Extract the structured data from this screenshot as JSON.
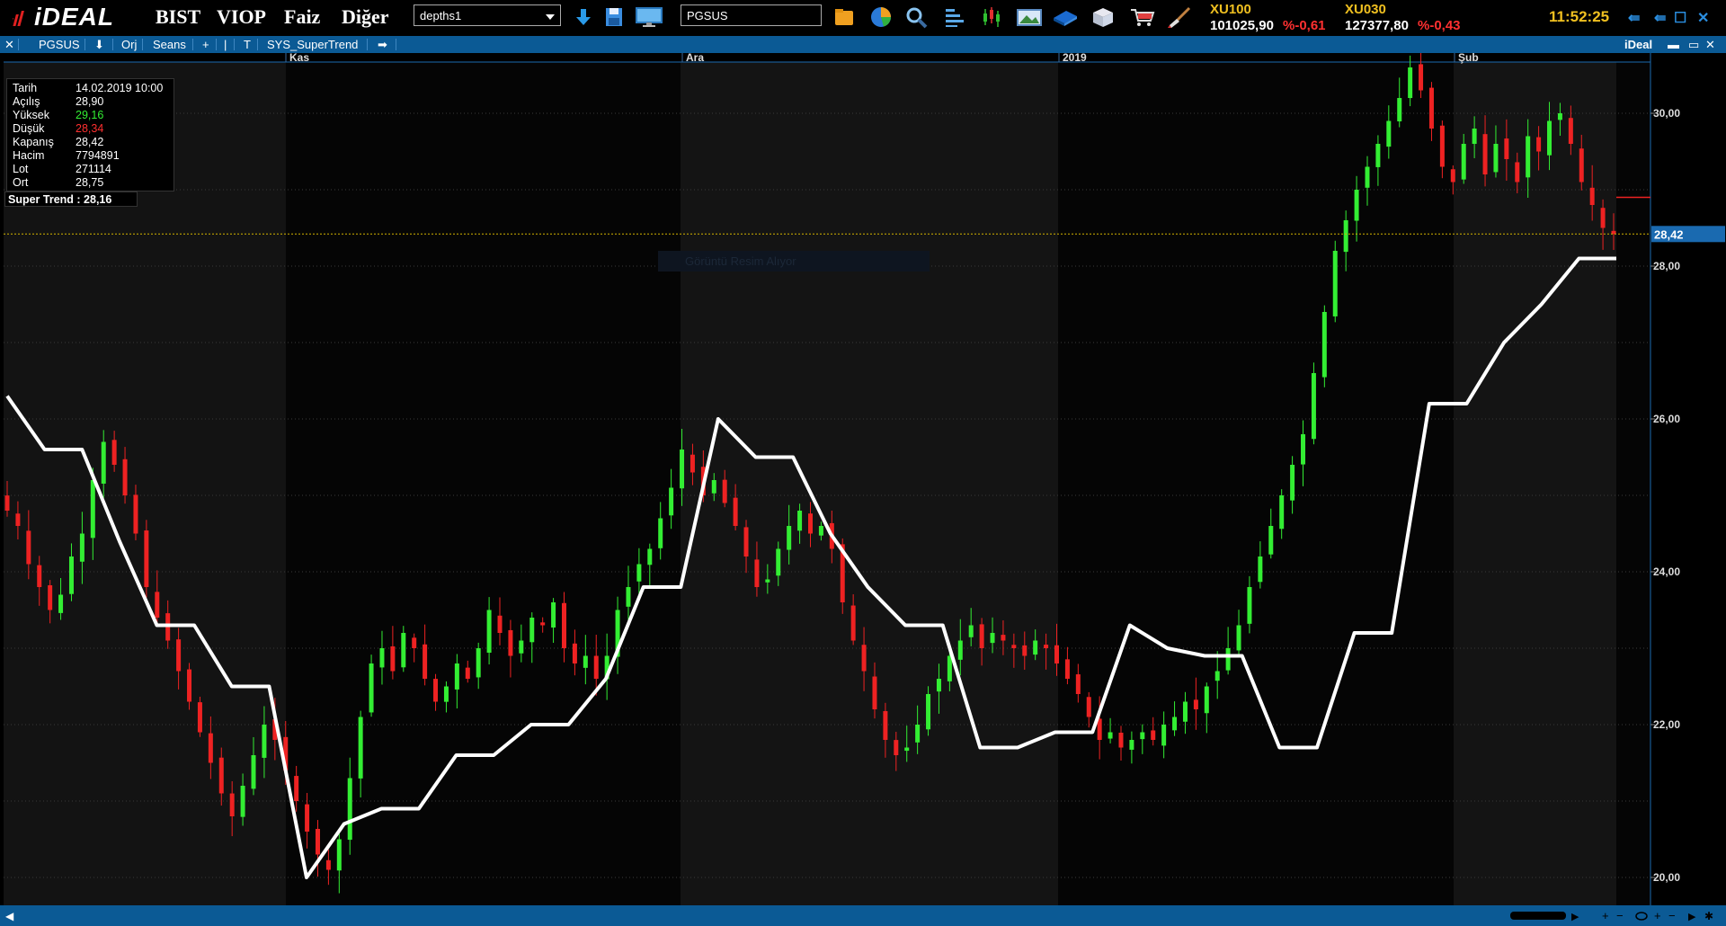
{
  "app": {
    "logo": "iDEAL",
    "menu": [
      "BIST",
      "VIOP",
      "Faiz",
      "Diğer"
    ],
    "layout_combo": "depths1",
    "symbol_input": "PGSUS",
    "clock": "11:52:25"
  },
  "toolbar_icons": [
    "download-icon",
    "save-icon",
    "monitor-icon",
    "folder-icon",
    "pie-chart-icon",
    "zoom-icon",
    "bar-list-icon",
    "candlestick-icon",
    "image-icon",
    "book-icon",
    "box-icon",
    "cart-icon",
    "brush-icon"
  ],
  "indices": [
    {
      "name": "XU100",
      "value": "101025,90",
      "change": "%-0,61"
    },
    {
      "name": "XU030",
      "value": "127377,80",
      "change": "%-0,43"
    }
  ],
  "window_buttons": [
    "⇚",
    "⇚",
    "☐",
    "✕"
  ],
  "chart_toolbar": {
    "items": [
      "✕",
      "PGSUS",
      "⬇",
      "Orj",
      "Seans",
      "+",
      "|",
      "T",
      "SYS_SuperTrend",
      "➡"
    ],
    "right_label": "iDeal",
    "right_controls": [
      "▬",
      "▭",
      "✕"
    ]
  },
  "info": {
    "rows": [
      {
        "label": "Tarih",
        "value": "14.02.2019 10:00",
        "color": "#ffffff"
      },
      {
        "label": "Açılış",
        "value": "28,90",
        "color": "#ffffff"
      },
      {
        "label": "Yüksek",
        "value": "29,16",
        "color": "#33ee33"
      },
      {
        "label": "Düşük",
        "value": "28,34",
        "color": "#ff3030"
      },
      {
        "label": "Kapanış",
        "value": "28,42",
        "color": "#ffffff"
      },
      {
        "label": "Hacim",
        "value": "7794891",
        "color": "#ffffff"
      },
      {
        "label": "Lot",
        "value": "271114",
        "color": "#ffffff"
      },
      {
        "label": "Ort",
        "value": "28,75",
        "color": "#ffffff"
      }
    ],
    "supertrend": "Super Trend : 28,16"
  },
  "watermark": "Görüntü Resim Alıyor",
  "chart_data": {
    "type": "candlestick",
    "symbol": "PGSUS",
    "indicator": "SYS_SuperTrend",
    "x_labels": [
      "Kas",
      "Ara",
      "2019",
      "Şub"
    ],
    "ylim": [
      19.6,
      31.2
    ],
    "y_ticks": [
      "20,00",
      "22,00",
      "24,00",
      "26,00",
      "28,00",
      "30,00"
    ],
    "last_price": "28,42",
    "last_price_value": 28.42,
    "candles_close": [
      24.8,
      24.6,
      24.1,
      23.8,
      23.5,
      23.7,
      24.2,
      24.5,
      25.2,
      25.7,
      25.4,
      25.0,
      24.5,
      23.8,
      23.4,
      23.1,
      22.7,
      22.3,
      21.9,
      21.5,
      21.1,
      20.8,
      21.2,
      21.6,
      22.0,
      21.8,
      21.4,
      21.0,
      20.6,
      20.3,
      20.1,
      20.5,
      21.3,
      22.1,
      22.8,
      23.0,
      22.7,
      23.2,
      23.0,
      22.6,
      22.3,
      22.5,
      22.8,
      22.6,
      23.0,
      23.5,
      23.2,
      22.9,
      23.1,
      23.4,
      23.3,
      23.6,
      23.0,
      22.8,
      22.9,
      22.6,
      22.9,
      23.5,
      23.8,
      24.1,
      24.3,
      24.7,
      25.1,
      25.6,
      25.3,
      25.0,
      25.2,
      24.9,
      24.6,
      24.2,
      23.8,
      23.9,
      24.3,
      24.6,
      24.8,
      24.5,
      24.6,
      24.3,
      23.6,
      23.1,
      22.7,
      22.2,
      21.8,
      21.6,
      21.7,
      22.0,
      22.4,
      22.6,
      22.9,
      23.1,
      23.3,
      23.0,
      23.2,
      23.1,
      23.0,
      22.9,
      23.1,
      23.0,
      22.8,
      22.6,
      22.4,
      22.1,
      21.8,
      21.9,
      21.7,
      21.8,
      21.9,
      21.8,
      22.0,
      22.1,
      22.3,
      22.2,
      22.5,
      22.7,
      23.0,
      23.3,
      23.8,
      24.2,
      24.6,
      25.0,
      25.4,
      25.8,
      26.6,
      27.4,
      28.2,
      28.6,
      29.0,
      29.3,
      29.6,
      29.9,
      30.2,
      30.6,
      30.3,
      29.8,
      29.3,
      29.1,
      29.6,
      29.8,
      29.2,
      29.6,
      29.4,
      29.1,
      29.7,
      29.5,
      29.9,
      30.0,
      29.6,
      29.1,
      28.8,
      28.5,
      28.42
    ],
    "supertrend_levels": [
      26.3,
      25.6,
      25.6,
      24.4,
      23.3,
      23.3,
      22.5,
      22.5,
      20.0,
      20.7,
      20.9,
      20.9,
      21.6,
      21.6,
      22.0,
      22.0,
      22.6,
      23.8,
      23.8,
      26.0,
      25.5,
      25.5,
      24.5,
      23.8,
      23.3,
      23.3,
      21.7,
      21.7,
      21.9,
      21.9,
      23.3,
      23.0,
      22.9,
      22.9,
      21.7,
      21.7,
      23.2,
      23.2,
      26.2,
      26.2,
      27.0,
      27.5,
      28.1,
      28.1
    ]
  }
}
